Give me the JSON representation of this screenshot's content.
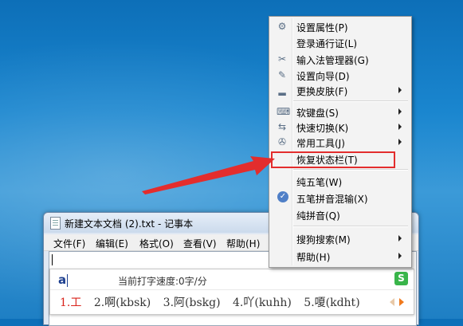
{
  "notepad": {
    "title": "新建文本文档 (2).txt - 记事本",
    "menu": [
      "文件(F)",
      "编辑(E)",
      "格式(O)",
      "查看(V)",
      "帮助(H)"
    ]
  },
  "ime": {
    "input": "a",
    "speed": "当前打字速度:0字/分",
    "logo": "S",
    "candidates": [
      "1.工",
      "2.啊(kbsk)",
      "3.阿(bskg)",
      "4.吖(kuhh)",
      "5.嗄(kdht)"
    ]
  },
  "menu": {
    "items": [
      {
        "label": "设置属性(P)",
        "icon": "gear-icon",
        "glyph": "⚙",
        "submenu": false
      },
      {
        "label": "登录通行证(L)",
        "icon": "",
        "glyph": "",
        "submenu": false
      },
      {
        "label": "输入法管理器(G)",
        "icon": "tools-icon",
        "glyph": "✂",
        "submenu": false
      },
      {
        "label": "设置向导(D)",
        "icon": "wand-icon",
        "glyph": "✎",
        "submenu": false
      },
      {
        "label": "更换皮肤(F)",
        "icon": "brush-icon",
        "glyph": "▂",
        "submenu": true
      },
      {
        "label": "软键盘(S)",
        "icon": "keyboard-icon",
        "glyph": "⌨",
        "submenu": true
      },
      {
        "label": "快速切换(K)",
        "icon": "switch-icon",
        "glyph": "⇆",
        "submenu": true
      },
      {
        "label": "常用工具(J)",
        "icon": "wrench-icon",
        "glyph": "✇",
        "submenu": true
      },
      {
        "label": "恢复状态栏(T)",
        "icon": "",
        "glyph": "",
        "submenu": false
      },
      {
        "label": "纯五笔(W)",
        "icon": "",
        "glyph": "",
        "submenu": false
      },
      {
        "label": "五笔拼音混输(X)",
        "icon": "check-icon",
        "glyph": "✓",
        "submenu": false
      },
      {
        "label": "纯拼音(Q)",
        "icon": "",
        "glyph": "",
        "submenu": false
      },
      {
        "label": "搜狗搜索(M)",
        "icon": "",
        "glyph": "",
        "submenu": true
      },
      {
        "label": "帮助(H)",
        "icon": "",
        "glyph": "",
        "submenu": true
      }
    ]
  },
  "colors": {
    "highlight_box": "#e32d2d",
    "arrow": "#e32d2d",
    "first_candidate": "#d9231b"
  }
}
